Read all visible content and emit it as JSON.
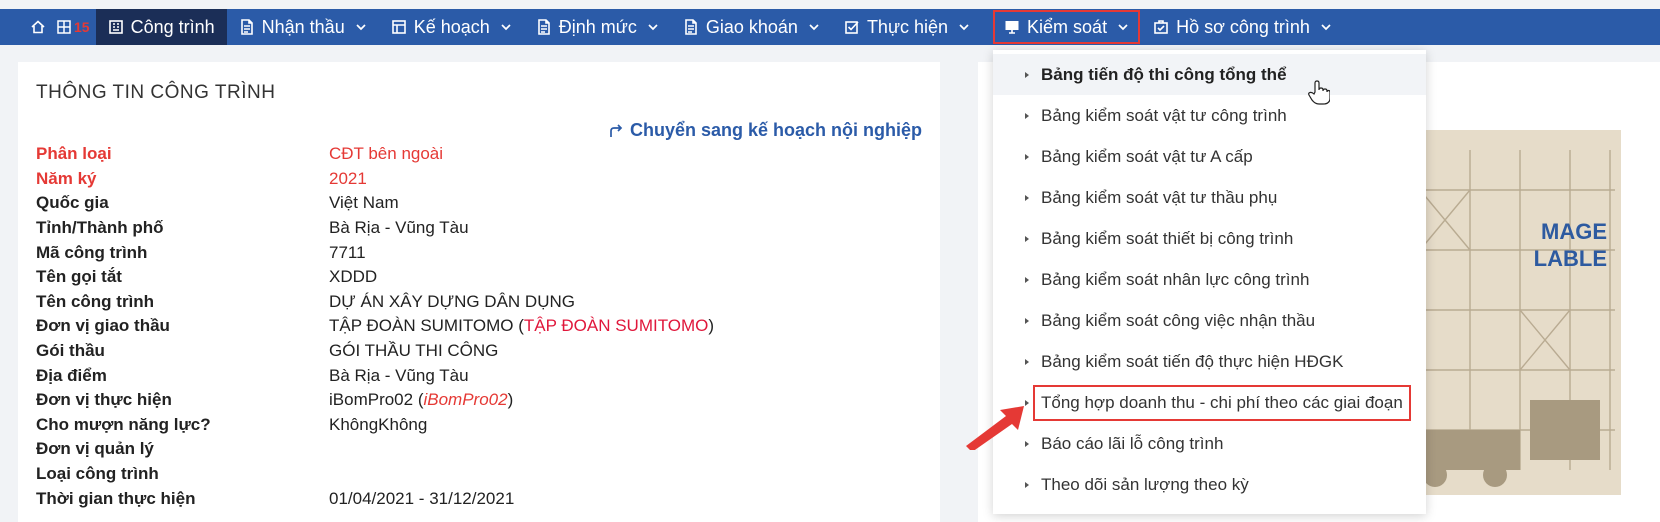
{
  "nav": {
    "home_icon": "home-icon",
    "grid_icon": "grid-icon",
    "grid_number": "15",
    "items": [
      {
        "label": "Công trình",
        "icon": "building-icon",
        "dropdown": false,
        "active": true
      },
      {
        "label": "Nhận thầu",
        "icon": "document-icon",
        "dropdown": true
      },
      {
        "label": "Kế hoạch",
        "icon": "table-icon",
        "dropdown": true
      },
      {
        "label": "Định mức",
        "icon": "document-icon",
        "dropdown": true
      },
      {
        "label": "Giao khoán",
        "icon": "document-icon",
        "dropdown": true
      },
      {
        "label": "Thực hiện",
        "icon": "checkbox-icon",
        "dropdown": true
      },
      {
        "label": "Kiểm soát",
        "icon": "monitor-icon",
        "dropdown": true,
        "highlighted": true
      },
      {
        "label": "Hồ sơ công trình",
        "icon": "briefcase-icon",
        "dropdown": true
      }
    ]
  },
  "info": {
    "title": "THÔNG TIN CÔNG TRÌNH",
    "plan_link": "Chuyển sang kế hoạch nội nghiệp",
    "rows": [
      {
        "label": "Phân loại",
        "value": "CĐT bên ngoài",
        "red": true
      },
      {
        "label": "Năm ký",
        "value": "2021",
        "red": true
      },
      {
        "label": "Quốc gia",
        "value": "Việt Nam"
      },
      {
        "label": "Tỉnh/Thành phố",
        "value": "Bà Rịa - Vũng Tàu"
      },
      {
        "label": "Mã công trình",
        "value": "7711"
      },
      {
        "label": "Tên gọi tắt",
        "value": "XDDD"
      },
      {
        "label": "Tên công trình",
        "value": "DỰ ÁN XÂY DỰNG DÂN DỤNG"
      },
      {
        "label": "Đơn vị giao thầu",
        "value": "TẬP ĐOÀN SUMITOMO (",
        "extra": "TẬP ĐOÀN SUMITOMO",
        "extra_style": "red",
        "suffix": ")"
      },
      {
        "label": "Gói thầu",
        "value": "GÓI THẦU THI CÔNG"
      },
      {
        "label": "Địa điểm",
        "value": "Bà Rịa - Vũng Tàu"
      },
      {
        "label": "Đơn vị thực hiện",
        "value": "iBomPro02 (",
        "extra": "iBomPro02",
        "extra_style": "italic",
        "suffix": ")"
      },
      {
        "label": "Cho mượn năng lực?",
        "value": "KhôngKhông"
      },
      {
        "label": "Đơn vị quản lý",
        "value": ""
      },
      {
        "label": "Loại công trình",
        "value": ""
      },
      {
        "label": "Thời gian thực hiện",
        "value": "01/04/2021 - 31/12/2021"
      }
    ]
  },
  "image_placeholder": {
    "line1": "MAGE",
    "line2": "LABLE"
  },
  "dropdown": {
    "items": [
      {
        "label": "Bảng tiến độ thi công tổng thể",
        "hover": true
      },
      {
        "label": "Bảng kiểm soát vật tư công trình"
      },
      {
        "label": "Bảng kiểm soát vật tư A cấp"
      },
      {
        "label": "Bảng kiểm soát vật tư thầu phụ"
      },
      {
        "label": "Bảng kiểm soát thiết bị công trình"
      },
      {
        "label": "Bảng kiểm soát nhân lực công trình"
      },
      {
        "label": "Bảng kiểm soát công việc nhận thầu"
      },
      {
        "label": "Bảng kiểm soát tiến độ thực hiện HĐGK"
      },
      {
        "label": "Tổng hợp doanh thu - chi phí theo các giai đoạn",
        "marked": true
      },
      {
        "label": "Báo cáo lãi lỗ công trình"
      },
      {
        "label": "Theo dõi sản lượng theo kỳ"
      }
    ]
  },
  "colors": {
    "nav_bg": "#2b5ba8",
    "nav_active": "#1b2e57",
    "highlight": "#e53935",
    "link": "#2b5ba8"
  }
}
